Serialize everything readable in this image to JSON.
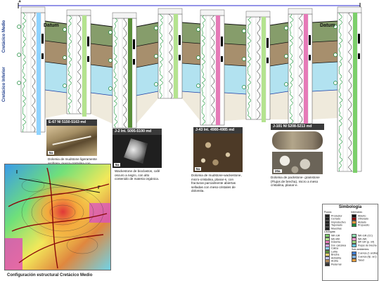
{
  "figure": {
    "scale_label": "1'",
    "datum_left": "Datum",
    "datum_right": "Datum",
    "section_title_middle": "Cretácico Medio",
    "section_title_lower": "Cretácico Inferior",
    "well_header_lines": [
      "J-21",
      "E-67",
      "J-43",
      "J-2",
      "J-79",
      "J-101",
      "J-15",
      "J-33",
      "E-40"
    ]
  },
  "cores": [
    {
      "id": "e67",
      "title": "E-67   Nl 5150-5163 md",
      "scale": "5a",
      "caption": "Dolomia de mudstone ligeramente arcillosa, macro-cristalina con microfracturas parcialmente abiertas sellada con calcita.",
      "colors": [
        "#8e7a5a",
        "#c9b58a",
        "#6a5638"
      ]
    },
    {
      "id": "j2",
      "title": "J-2   Int. 5095-5100 md",
      "scale": "5a",
      "caption": "Wackestone de bioclastos, café oscuro a negro, con alto contenido de materia orgánica.",
      "colors": [
        "#2b2b2b",
        "#d8d8d8",
        "#6e6e6e"
      ]
    },
    {
      "id": "j43",
      "title": "J-43   Int. 4980-4985 md",
      "scale": "5a",
      "caption": "Dolomia de mudstone-wackestone, micro-cristalina, planar-s, con fracturas parcialmente abiertas selladas con meso-cristales de dolomita.",
      "colors": [
        "#5b4631",
        "#a8906b",
        "#d9c7a4"
      ]
    },
    {
      "id": "j101",
      "title": "J-101  Nl 5208-5213 md",
      "scale": "20a",
      "caption": "Dolomia de packstone- grainstone (Flujos de brecha), micro a meso cristalina, planar-e.",
      "colors": [
        "#8a7d69",
        "#b8a98b",
        "#e7e2d6"
      ]
    }
  ],
  "legend": {
    "title": "Simbología",
    "pozo_header": "Pozos:",
    "pozos": [
      "Productor",
      "Cerrado",
      "Improductivo",
      "Taponado",
      "Muestras"
    ],
    "intervalos_header": "Intervalos:",
    "intervalos": [
      "Abierto",
      "Obturado",
      "Aislado",
      "Propuesto"
    ],
    "litologia_header": "Litologías:",
    "lithologies": [
      {
        "label": "WK-GR",
        "color": "#7ccf6b"
      },
      {
        "label": "MD-WK",
        "color": "#b4e38f"
      },
      {
        "label": "Dolomia",
        "color": "#e67ab8"
      },
      {
        "label": "Dol. calcárea",
        "color": "#d1a3e0"
      },
      {
        "label": "Caliza",
        "color": "#8fd3ff"
      },
      {
        "label": "Lutita",
        "color": "#5a8f3a"
      },
      {
        "label": "Brecha",
        "color": "#f0d36c"
      },
      {
        "label": "Anhidrita",
        "color": "#c7c7ff"
      },
      {
        "label": "Arcilla",
        "color": "#b58b5a"
      },
      {
        "label": "Pedernal",
        "color": "#333333"
      }
    ],
    "right_lithologies": [
      {
        "label": "WK-GR (CC)",
        "color": "#8de0b0"
      },
      {
        "label": "WK-WK",
        "color": "#f59bd0"
      },
      {
        "label": "MF-GR (p. mf)",
        "color": "#9ad67d"
      },
      {
        "label": "Flujos de brecha",
        "color": "#63c7e8"
      }
    ],
    "subambientes_header": "Sub-ambientes:",
    "subambientes": [
      {
        "label": "Cuenca (1 arcilla)",
        "color": "#3a7bd5"
      },
      {
        "label": "Cuenca (tip. arc)",
        "color": "#7fb8f2"
      },
      {
        "label": "Talud",
        "color": "#e39b3b"
      }
    ]
  },
  "map": {
    "title": "Configuración  estructural  Cretácico Medio",
    "labels": [
      "I",
      "I'"
    ]
  },
  "colors": {
    "corr_green": "#5e7c3a",
    "corr_brown": "#8a6a3c",
    "corr_blue": "#7fcfe6",
    "well_bg": "#ffffff",
    "log_green": "#1f9b3d",
    "log_black": "#000000"
  }
}
